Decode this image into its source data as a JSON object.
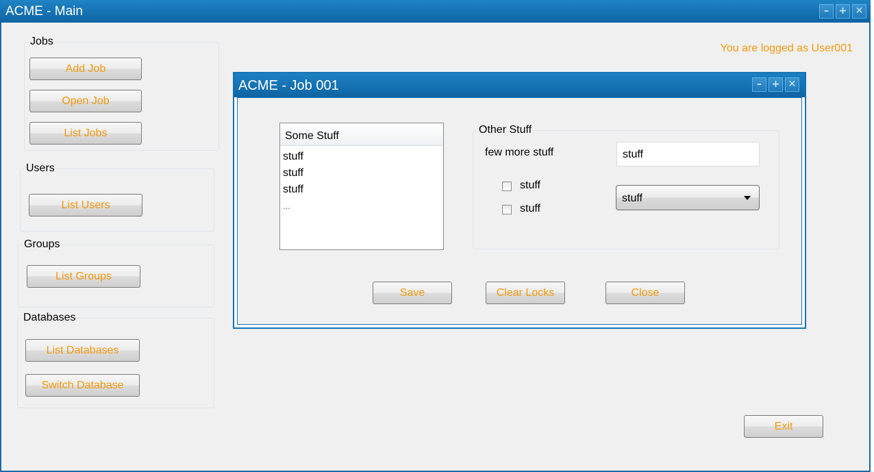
{
  "main_window": {
    "title": "ACME - Main",
    "controls": {
      "minimize": "–",
      "maximize": "+",
      "close": "✕"
    },
    "login_status": "You are logged as User001",
    "exit_label": "Exit"
  },
  "sidebar": {
    "jobs": {
      "legend": "Jobs",
      "add": "Add Job",
      "open": "Open Job",
      "list": "List Jobs"
    },
    "users": {
      "legend": "Users",
      "list": "List Users"
    },
    "groups": {
      "legend": "Groups",
      "list": "List Groups"
    },
    "databases": {
      "legend": "Databases",
      "list": "List Databases",
      "switch": "Switch Database"
    }
  },
  "job_window": {
    "title": "ACME - Job 001",
    "controls": {
      "minimize": "–",
      "maximize": "+",
      "close": "✕"
    },
    "list": {
      "header": "Some Stuff",
      "items": [
        "stuff",
        "stuff",
        "stuff",
        "..."
      ]
    },
    "other": {
      "legend": "Other Stuff",
      "field_label": "few more stuff",
      "field_value": "stuff",
      "checkbox1_label": "stuff",
      "checkbox2_label": "stuff",
      "dropdown_value": "stuff"
    },
    "buttons": {
      "save": "Save",
      "clear_locks": "Clear Locks",
      "close": "Close"
    }
  },
  "colors": {
    "accent": "#f4990d",
    "titlebar": "#1672b3"
  }
}
